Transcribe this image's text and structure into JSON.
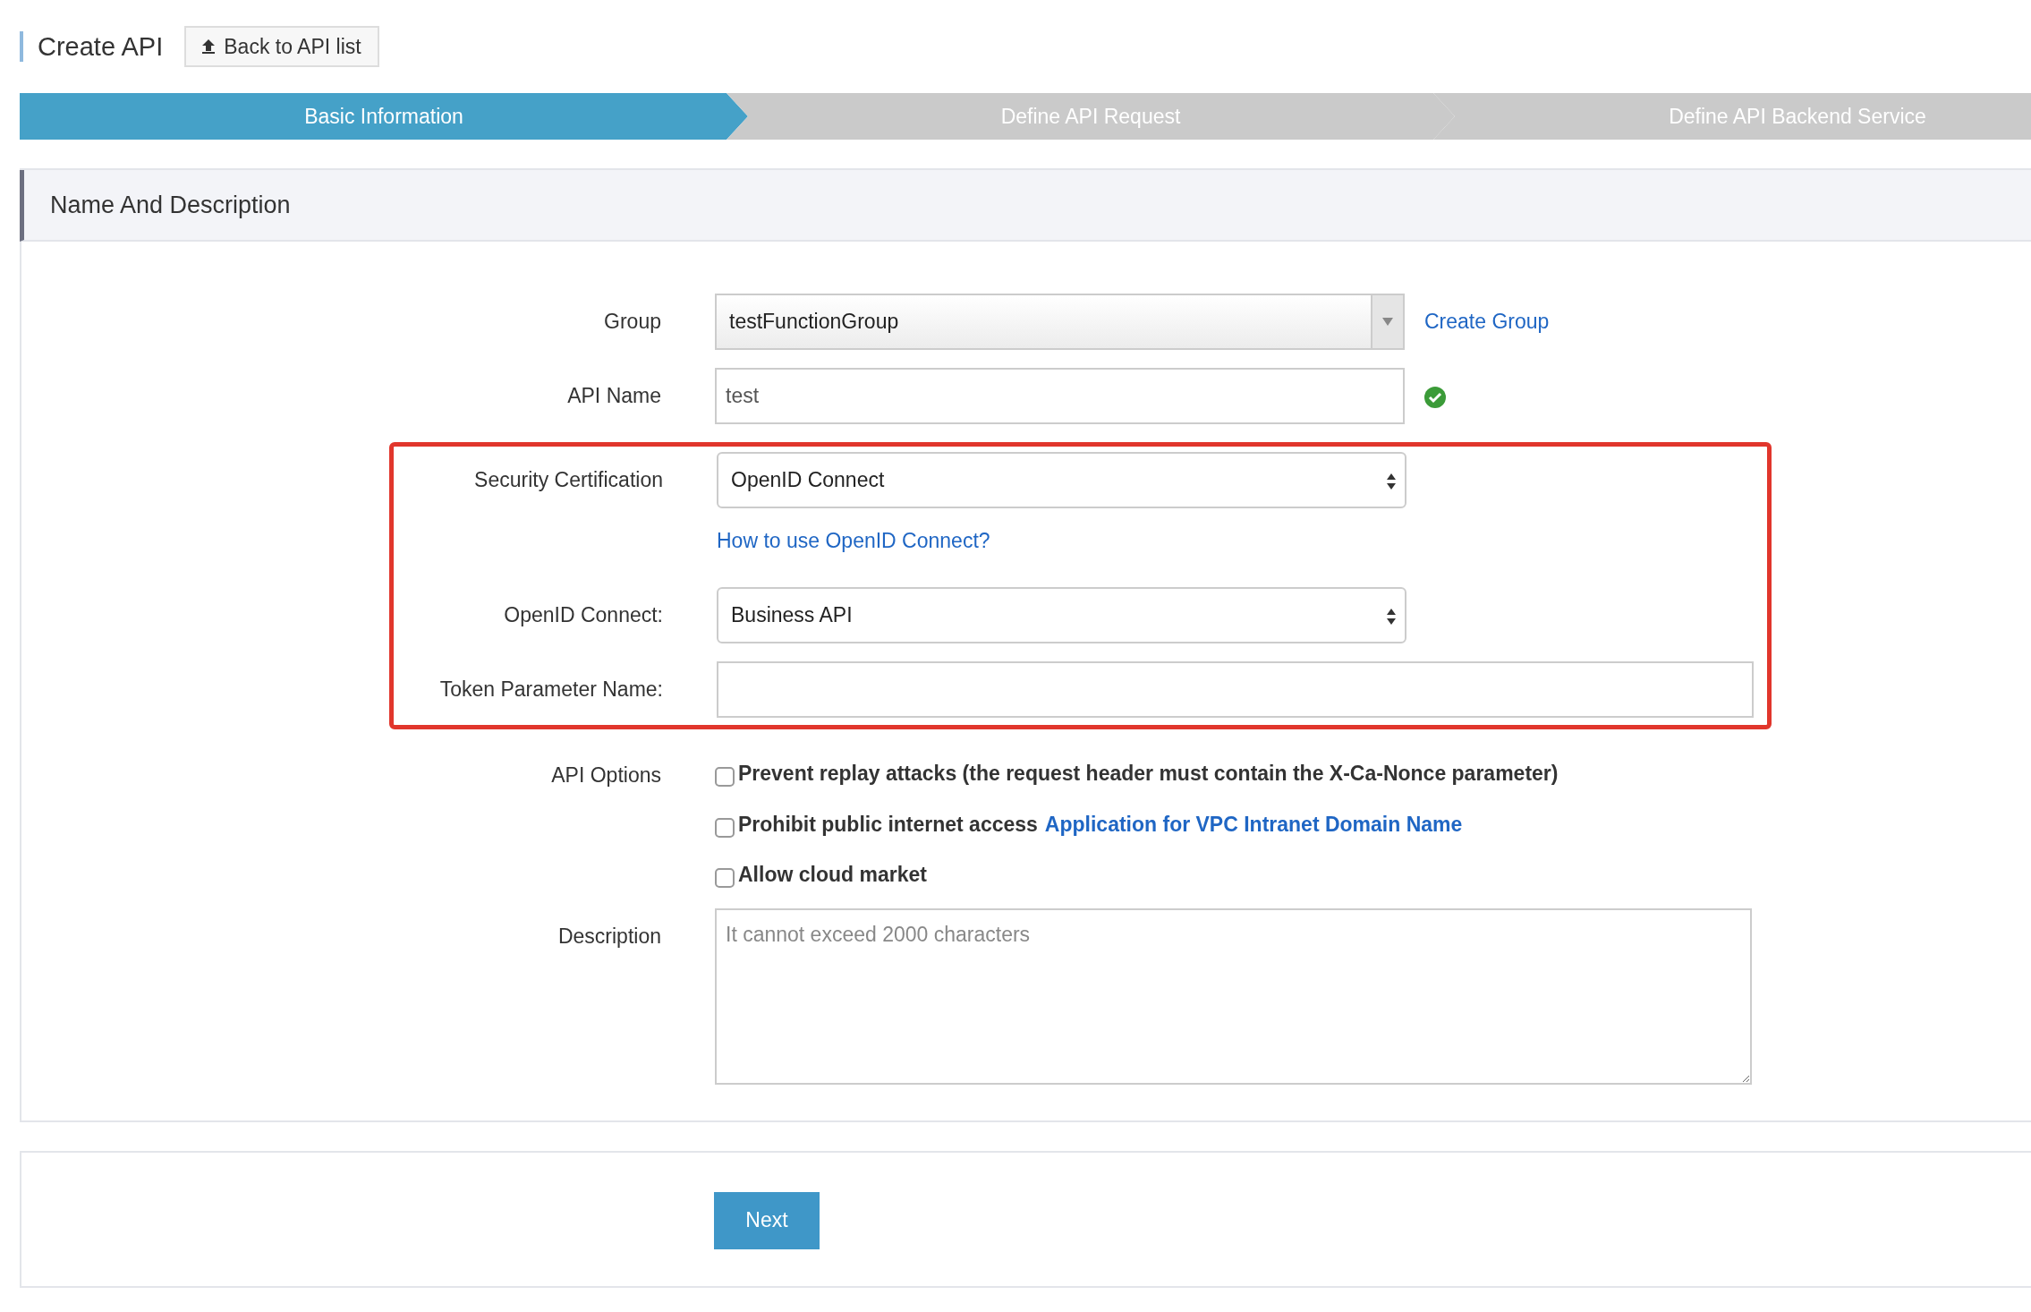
{
  "header": {
    "title": "Create API",
    "back_button": "Back to API list"
  },
  "steps": [
    {
      "label": "Basic Information",
      "selected": true
    },
    {
      "label": "Define API Request",
      "selected": false
    },
    {
      "label": "Define API Backend Service",
      "selected": false
    }
  ],
  "section": {
    "title": "Name And Description"
  },
  "fields": [
    {
      "kind": "combo",
      "label": "Group",
      "value": "testFunctionGroup",
      "link": "Create Group"
    },
    {
      "kind": "text",
      "label": "API Name",
      "value": "test",
      "valid": true
    },
    {
      "kind": "highlight_group",
      "fields": [
        {
          "kind": "select",
          "label": "Security Certification",
          "value": "OpenID Connect",
          "help_link": "How to use OpenID Connect?"
        },
        {
          "kind": "select",
          "label": "OpenID Connect:",
          "value": "Business API"
        },
        {
          "kind": "wide_text",
          "label": "Token Parameter Name:"
        }
      ]
    }
  ],
  "options": {
    "label": "API Options",
    "items": [
      {
        "text": "Prevent replay attacks (the request header must contain the X-Ca-Nonce parameter)",
        "checked": false
      },
      {
        "text": "Prohibit public internet access",
        "link": "Application for VPC Intranet Domain Name",
        "checked": false
      },
      {
        "text": "Allow cloud market",
        "checked": false
      }
    ]
  },
  "description": {
    "label": "Description",
    "placeholder": "It cannot exceed 2000 characters"
  },
  "next_button": "Next"
}
